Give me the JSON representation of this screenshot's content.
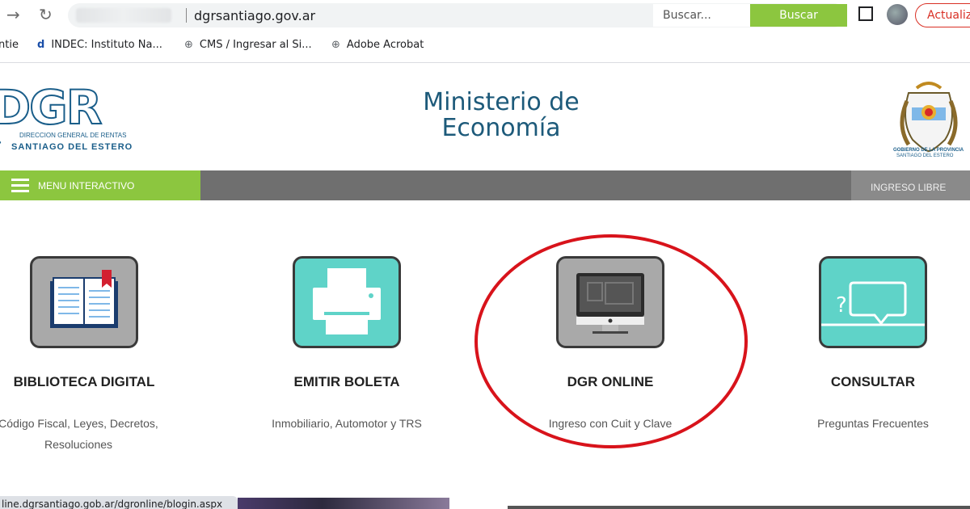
{
  "browser": {
    "url": "dgrsantiago.gov.ar",
    "update_label": "Actualiza",
    "bookmarks": [
      {
        "label": "ntie"
      },
      {
        "label": "INDEC: Instituto Na..."
      },
      {
        "label": "CMS / Ingresar al Si..."
      },
      {
        "label": "Adobe Acrobat"
      }
    ],
    "status_url": "line.dgrsantiago.gob.ar/dgronline/blogin.aspx"
  },
  "header": {
    "logo_letters": "DGR",
    "logo_line1": "DIRECCION GENERAL DE RENTAS",
    "logo_line2": "SANTIAGO DEL ESTERO",
    "title_line1": "Ministerio de",
    "title_line2": "Economía",
    "coat_line1": "GOBIERNO DE LA PROVINCIA",
    "coat_line2": "SANTIAGO DEL ESTERO"
  },
  "menubar": {
    "menu_label": "MENU INTERACTIVO",
    "search_placeholder": "Buscar...",
    "search_button": "Buscar",
    "ingreso_label": "INGRESO LIBRE"
  },
  "cards": [
    {
      "title": "BIBLIOTECA DIGITAL",
      "subtitle": "Código Fiscal, Leyes, Decretos, Resoluciones",
      "icon": "book-icon",
      "color": "#a9a9a9"
    },
    {
      "title": "EMITIR BOLETA",
      "subtitle": "Inmobiliario, Automotor y TRS",
      "icon": "printer-icon",
      "color": "#5fd3c8"
    },
    {
      "title": "DGR ONLINE",
      "subtitle": "Ingreso con Cuit y Clave",
      "icon": "computer-icon",
      "color": "#a9a9a9"
    },
    {
      "title": "CONSULTAR",
      "subtitle": "Preguntas Frecuentes",
      "icon": "chat-icon",
      "color": "#5fd3c8"
    }
  ],
  "colors": {
    "accent_green": "#8cc63f",
    "brand_blue": "#1a5e8a",
    "highlight_red": "#d8131b"
  }
}
